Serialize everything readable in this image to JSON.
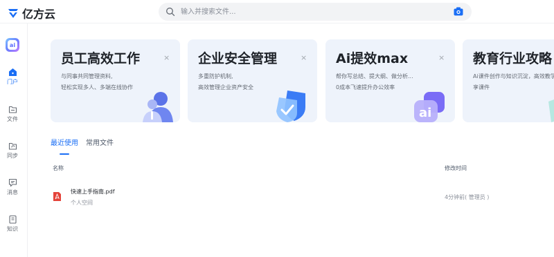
{
  "app": {
    "name": "亿方云"
  },
  "search": {
    "placeholder": "输入并搜索文件..."
  },
  "sidebar": {
    "items": [
      {
        "label": "门户",
        "icon": "home-icon",
        "active": true
      },
      {
        "label": "文件",
        "icon": "file-icon",
        "active": false
      },
      {
        "label": "同步",
        "icon": "sync-icon",
        "active": false
      },
      {
        "label": "消息",
        "icon": "message-icon",
        "active": false
      },
      {
        "label": "知识",
        "icon": "knowledge-icon",
        "active": false
      }
    ]
  },
  "cards": [
    {
      "title": "员工高效工作",
      "desc1": "与同事共同管理资料,",
      "desc2": "轻松实现多人、多端在线协作",
      "close": "×",
      "bg": "#eef3fb",
      "illus": "people-illustration"
    },
    {
      "title": "企业安全管理",
      "desc1": "多重防护机制,",
      "desc2": "高效管理企业资产安全",
      "close": "×",
      "bg": "#eef3fb",
      "illus": "shield-illustration"
    },
    {
      "title": "Ai提效max",
      "desc1": "帮你写总结、提大纲、做分析...",
      "desc2": "0成本飞速提升办公效率",
      "close": "×",
      "bg": "#eef3fb",
      "illus": "ai-illustration"
    },
    {
      "title": "教育行业攻略",
      "desc1": "Ai课件创作与知识沉淀，高效教学",
      "desc2": "享课件",
      "close": "",
      "bg": "#eef3fb",
      "illus": "edu-illustration"
    }
  ],
  "tabs": [
    {
      "label": "最近使用",
      "active": true
    },
    {
      "label": "常用文件",
      "active": false
    }
  ],
  "table": {
    "headers": {
      "name": "名称",
      "modified": "修改时间"
    },
    "rows": [
      {
        "name": "快速上手指南.pdf",
        "location": "个人空间",
        "modified": "4分钟前( 管理员 )",
        "icon": "pdf-icon"
      }
    ]
  },
  "colors": {
    "accent": "#1a6ef5",
    "pdf": "#e4433a",
    "card_bg": "#eef3fb"
  }
}
